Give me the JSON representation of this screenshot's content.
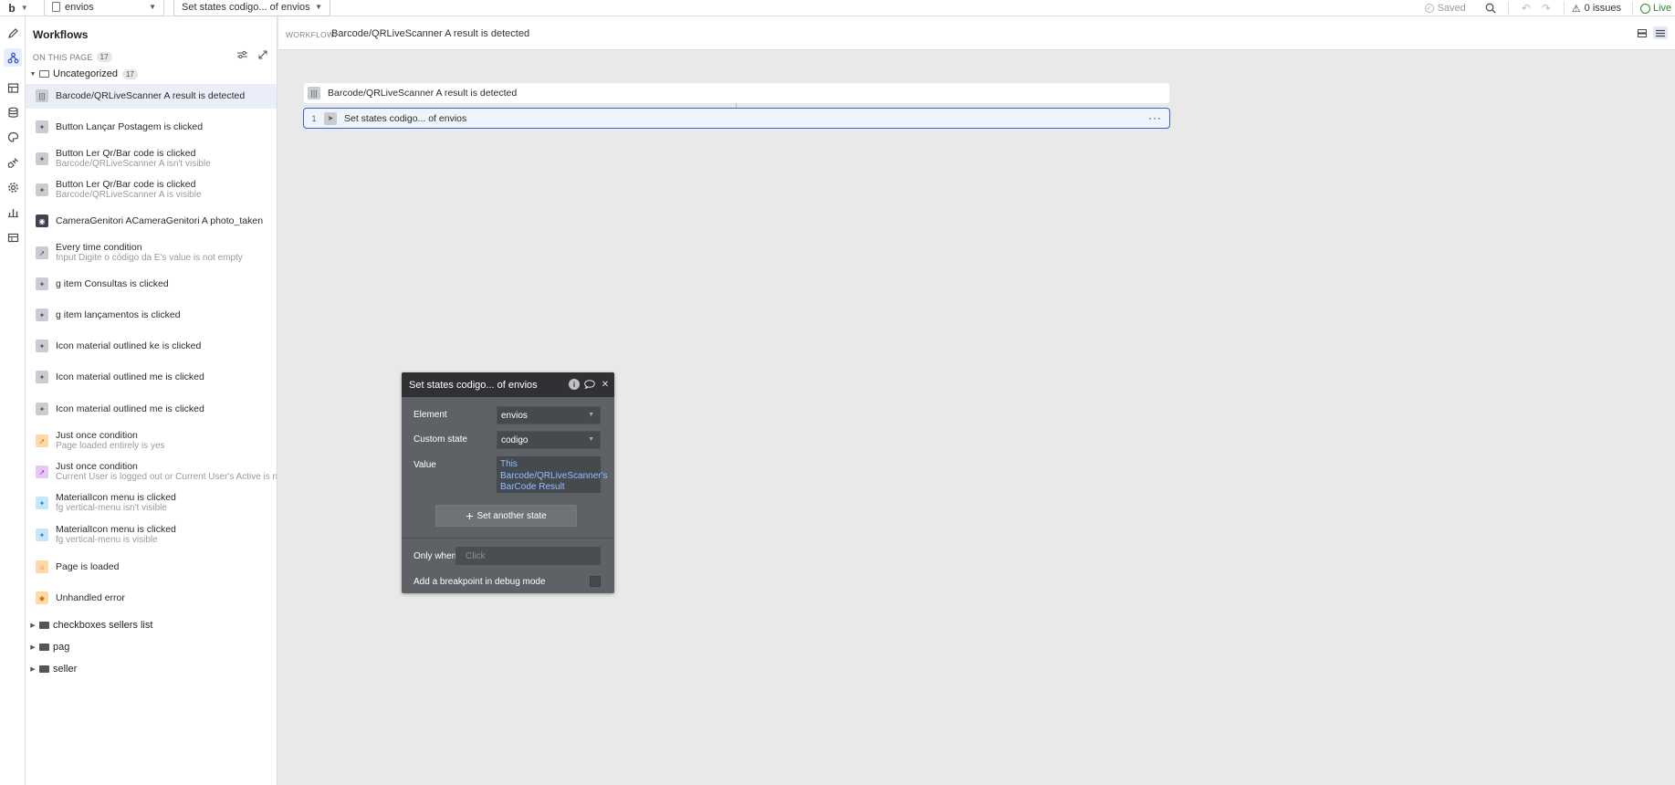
{
  "topbar": {
    "logo": "b",
    "page_dropdown": "envios",
    "workflow_dropdown": "Set states codigo... of envios",
    "saved_label": "Saved",
    "issues_label": "0 issues",
    "live_label": "Live"
  },
  "rail": {
    "items": [
      "design-icon",
      "workflow-icon",
      "data-icon",
      "database-icon",
      "styles-icon",
      "plugins-icon",
      "settings-icon",
      "logs-icon",
      "table-icon"
    ]
  },
  "panel": {
    "title": "Workflows",
    "on_this_page_label": "ON THIS PAGE",
    "on_this_page_count": "17",
    "folders": [
      {
        "name": "Uncategorized",
        "count": "17"
      },
      {
        "name": "checkboxes sellers list"
      },
      {
        "name": "pag"
      },
      {
        "name": "seller"
      }
    ],
    "workflows": [
      {
        "name": "Barcode/QRLiveScanner A result is detected",
        "condition": "",
        "icon": "barcode-icon"
      },
      {
        "name": "Button Lançar Postagem is clicked",
        "condition": "",
        "icon": "click-icon"
      },
      {
        "name": "Button Ler Qr/Bar code is clicked",
        "condition": "Barcode/QRLiveScanner A isn't visible",
        "icon": "click-icon"
      },
      {
        "name": "Button Ler Qr/Bar code is clicked",
        "condition": "Barcode/QRLiveScanner A is visible",
        "icon": "click-icon"
      },
      {
        "name": "CameraGenitori ACameraGenitori A photo_taken",
        "condition": "",
        "icon": "camera-icon"
      },
      {
        "name": "Every time condition",
        "condition": "Input Digite o código da E's value is not empty",
        "icon": "condition-icon"
      },
      {
        "name": "g item Consultas is clicked",
        "condition": "",
        "icon": "click-icon"
      },
      {
        "name": "g item lançamentos is clicked",
        "condition": "",
        "icon": "click-icon"
      },
      {
        "name": "Icon material outlined ke is clicked",
        "condition": "",
        "icon": "click-icon"
      },
      {
        "name": "Icon material outlined me is clicked",
        "condition": "",
        "icon": "click-icon"
      },
      {
        "name": "Icon material outlined me is clicked",
        "condition": "",
        "icon": "click-icon"
      },
      {
        "name": "Just once condition",
        "condition": "Page loaded entirely is yes",
        "icon": "condition-icon"
      },
      {
        "name": "Just once condition",
        "condition": "Current User is logged out or Current User's Active is no",
        "icon": "condition-icon"
      },
      {
        "name": "MaterialIcon menu is clicked",
        "condition": "fg vertical-menu isn't visible",
        "icon": "click-icon"
      },
      {
        "name": "MaterialIcon menu is clicked",
        "condition": "fg vertical-menu is visible",
        "icon": "click-icon"
      },
      {
        "name": "Page is loaded",
        "condition": "",
        "icon": "page-load-icon"
      },
      {
        "name": "Unhandled error",
        "condition": "",
        "icon": "error-icon"
      }
    ]
  },
  "header": {
    "label": "WORKFLOW:",
    "workflow_name": "Barcode/QRLiveScanner A result is detected"
  },
  "canvas": {
    "event_name": "Barcode/QRLiveScanner A result is detected",
    "action_number": "1",
    "action_name": "Set states codigo... of envios",
    "more": "···"
  },
  "editor": {
    "title": "Set states codigo... of envios",
    "element_label": "Element",
    "element_value": "envios",
    "custom_state_label": "Custom state",
    "custom_state_value": "codigo",
    "value_label": "Value",
    "value_line1": "This",
    "value_line2": "Barcode/QRLiveScanner's",
    "value_line3": "BarCode Result",
    "set_another_label": "Set another state",
    "only_when_label": "Only when",
    "only_when_placeholder": "Click",
    "breakpoint_label": "Add a breakpoint in debug mode"
  },
  "colors": {
    "accent": "#3f5fd1",
    "editor_bg": "#5e6166",
    "editor_header": "#2f3135",
    "dynamic_text": "#8fc1ff",
    "live_green": "#2e8b3a"
  }
}
